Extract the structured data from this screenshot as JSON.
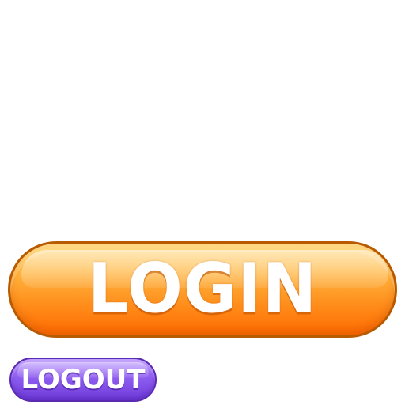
{
  "buttons": {
    "login_label": "LOGIN",
    "logout_label": "LOGOUT"
  },
  "colors": {
    "login_gradient_top": "#ffd36a",
    "login_gradient_bottom": "#ff6a00",
    "logout_gradient_top": "#b892ff",
    "logout_gradient_bottom": "#6e3ad9"
  }
}
